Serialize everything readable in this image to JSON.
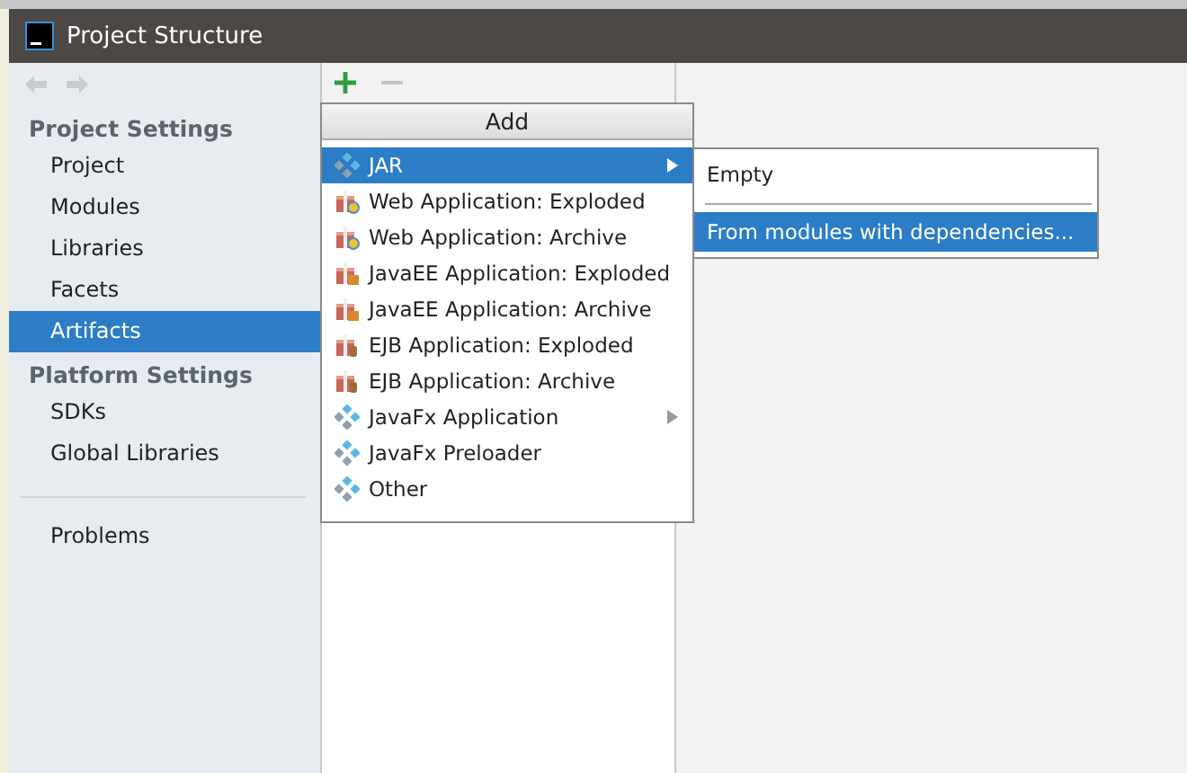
{
  "window": {
    "title": "Project Structure"
  },
  "sidebar": {
    "groups": [
      {
        "heading": "Project Settings",
        "items": [
          {
            "label": "Project",
            "selected": false
          },
          {
            "label": "Modules",
            "selected": false
          },
          {
            "label": "Libraries",
            "selected": false
          },
          {
            "label": "Facets",
            "selected": false
          },
          {
            "label": "Artifacts",
            "selected": true
          }
        ]
      },
      {
        "heading": "Platform Settings",
        "items": [
          {
            "label": "SDKs",
            "selected": false
          },
          {
            "label": "Global Libraries",
            "selected": false
          }
        ]
      }
    ],
    "footer_items": [
      {
        "label": "Problems",
        "selected": false
      }
    ]
  },
  "add_menu": {
    "title": "Add",
    "items": [
      {
        "label": "JAR",
        "kind": "diamond",
        "selected": true,
        "submenu": true
      },
      {
        "label": "Web Application: Exploded",
        "kind": "web",
        "selected": false,
        "submenu": false
      },
      {
        "label": "Web Application: Archive",
        "kind": "web",
        "selected": false,
        "submenu": false
      },
      {
        "label": "JavaEE Application: Exploded",
        "kind": "javaee",
        "selected": false,
        "submenu": false
      },
      {
        "label": "JavaEE Application: Archive",
        "kind": "javaee",
        "selected": false,
        "submenu": false
      },
      {
        "label": "EJB Application: Exploded",
        "kind": "ejb",
        "selected": false,
        "submenu": false
      },
      {
        "label": "EJB Application: Archive",
        "kind": "ejb",
        "selected": false,
        "submenu": false
      },
      {
        "label": "JavaFx Application",
        "kind": "diamond",
        "selected": false,
        "submenu": true
      },
      {
        "label": "JavaFx Preloader",
        "kind": "diamond",
        "selected": false,
        "submenu": false
      },
      {
        "label": "Other",
        "kind": "diamond",
        "selected": false,
        "submenu": false
      }
    ]
  },
  "submenu": {
    "items": [
      {
        "label": "Empty",
        "selected": false
      },
      {
        "label": "From modules with dependencies...",
        "selected": true
      }
    ]
  }
}
